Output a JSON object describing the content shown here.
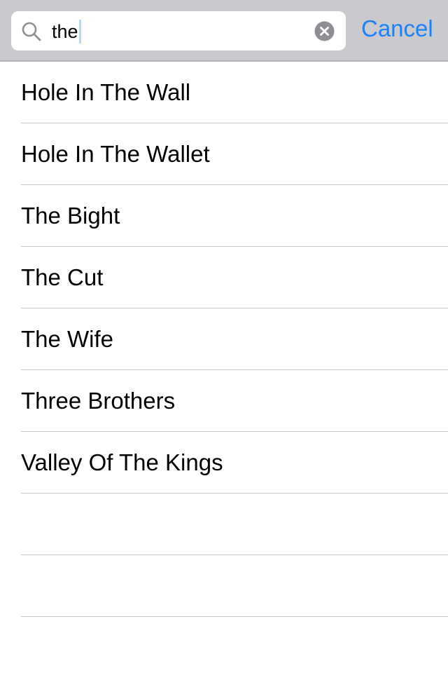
{
  "search": {
    "query": "the",
    "cancel_label": "Cancel"
  },
  "results": [
    "Hole In The Wall",
    "Hole In The Wallet",
    "The Bight",
    "The Cut",
    "The Wife",
    "Three Brothers",
    "Valley Of The Kings",
    "",
    ""
  ],
  "icons": {
    "search": "search-icon",
    "clear": "clear-icon"
  },
  "colors": {
    "accent": "#1a82fb",
    "search_bar_background": "#c9c9ce",
    "separator": "#c8c7cc",
    "clear_icon": "#8e8e93"
  }
}
